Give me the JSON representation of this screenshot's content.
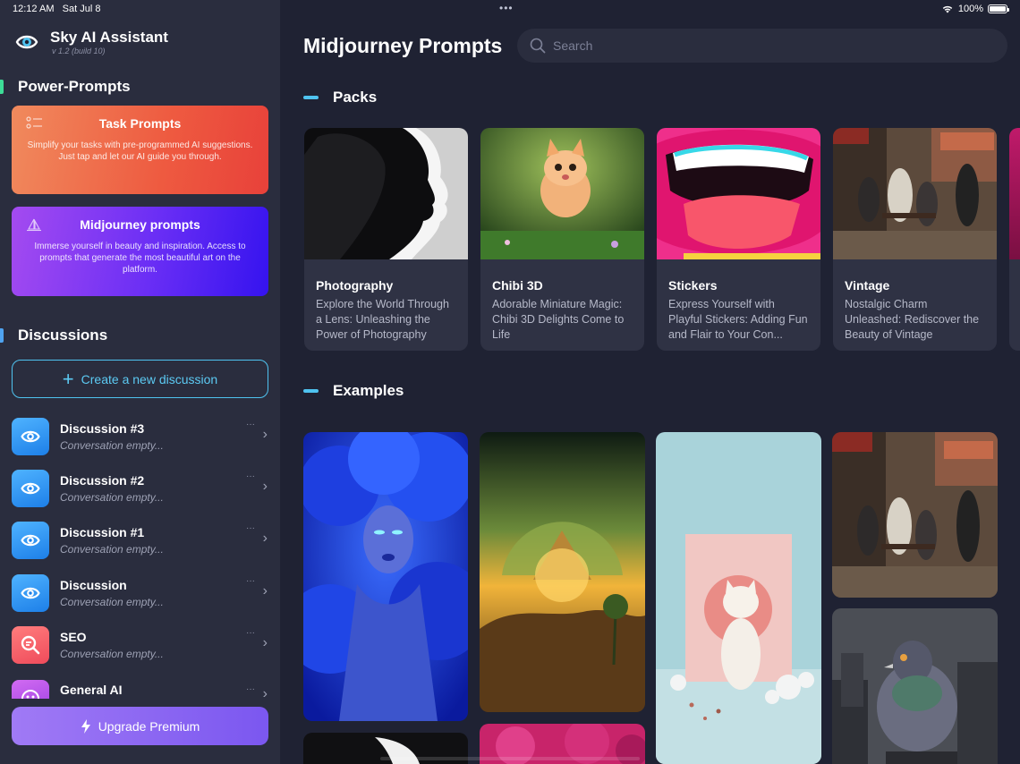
{
  "status": {
    "time": "12:12 AM",
    "date": "Sat Jul 8",
    "battery": "100%",
    "dots": "•••"
  },
  "brand": {
    "name": "Sky AI Assistant",
    "version": "v 1.2 (build 10)"
  },
  "sections": {
    "power_prompts": "Power-Prompts",
    "discussions": "Discussions"
  },
  "prompt_cards": [
    {
      "title": "Task Prompts",
      "desc": "Simplify your tasks with pre-programmed AI suggestions. Just tap and let our AI guide you through."
    },
    {
      "title": "Midjourney prompts",
      "desc": "Immerse yourself in beauty and inspiration. Access to prompts that generate the most beautiful art on the platform."
    }
  ],
  "create_label": "Create a new discussion",
  "discussions": [
    {
      "name": "Discussion #3",
      "sub": "Conversation empty..."
    },
    {
      "name": "Discussion #2",
      "sub": "Conversation empty..."
    },
    {
      "name": "Discussion #1",
      "sub": "Conversation empty..."
    },
    {
      "name": "Discussion",
      "sub": "Conversation empty..."
    },
    {
      "name": "SEO",
      "sub": "Conversation empty..."
    },
    {
      "name": "General AI",
      "sub": ""
    }
  ],
  "upgrade_label": "Upgrade Premium",
  "main": {
    "title": "Midjourney Prompts",
    "search_placeholder": "Search",
    "packs_heading": "Packs",
    "examples_heading": "Examples"
  },
  "packs": [
    {
      "title": "Photography",
      "desc": "Explore the World Through a Lens: Unleashing the Power of Photography"
    },
    {
      "title": "Chibi 3D",
      "desc": "Adorable Miniature Magic: Chibi 3D Delights Come to Life"
    },
    {
      "title": "Stickers",
      "desc": "Express Yourself with Playful Stickers: Adding Fun and Flair to Your Con..."
    },
    {
      "title": "Vintage",
      "desc": "Nostalgic Charm Unleashed: Rediscover the Beauty of Vintage"
    }
  ],
  "colors": {
    "accent": "#4fc3f0",
    "sidebar_bg": "#2a2d3e",
    "main_bg": "#1f2233"
  }
}
